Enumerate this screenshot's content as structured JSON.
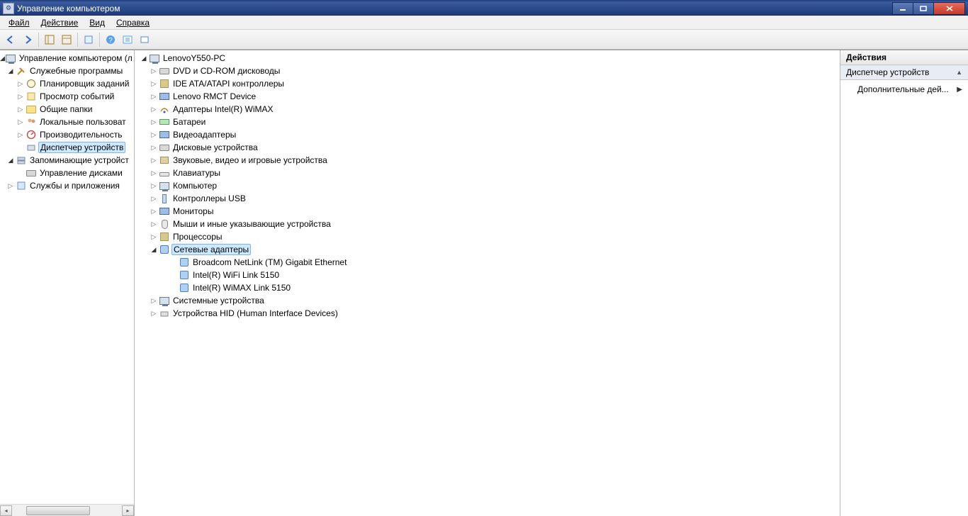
{
  "window": {
    "title": "Управление компьютером"
  },
  "menu": {
    "file": "Файл",
    "action": "Действие",
    "view": "Вид",
    "help": "Справка"
  },
  "toolbar": {
    "back": "←",
    "forward": "→"
  },
  "left_tree": {
    "root": "Управление компьютером (л",
    "system_tools": "Служебные программы",
    "st_items": {
      "task_scheduler": "Планировщик заданий",
      "event_viewer": "Просмотр событий",
      "shared_folders": "Общие папки",
      "local_users": "Локальные пользоват",
      "performance": "Производительность",
      "device_manager": "Диспетчер устройств"
    },
    "storage": "Запоминающие устройст",
    "storage_items": {
      "disk_mgmt": "Управление дисками"
    },
    "services": "Службы и приложения"
  },
  "center_tree": {
    "root": "LenovoY550-PC",
    "cats": {
      "dvd": "DVD и CD-ROM дисководы",
      "ide": "IDE ATA/ATAPI контроллеры",
      "lenovo": "Lenovo RMCT Device",
      "wimax_ad": "Адаптеры Intel(R) WiMAX",
      "battery": "Батареи",
      "video": "Видеоадаптеры",
      "disk": "Дисковые устройства",
      "sound": "Звуковые, видео и игровые устройства",
      "keyboard": "Клавиатуры",
      "computer": "Компьютер",
      "usb": "Контроллеры USB",
      "monitor": "Мониторы",
      "mouse": "Мыши и иные указывающие устройства",
      "cpu": "Процессоры",
      "network": "Сетевые адаптеры",
      "system": "Системные устройства",
      "hid": "Устройства HID (Human Interface Devices)"
    },
    "network_children": {
      "broadcom": "Broadcom NetLink (TM) Gigabit Ethernet",
      "wifi": "Intel(R) WiFi Link 5150",
      "wimax": "Intel(R) WiMAX Link 5150"
    }
  },
  "actions": {
    "header": "Действия",
    "section": "Диспетчер устройств",
    "more": "Дополнительные дей..."
  }
}
